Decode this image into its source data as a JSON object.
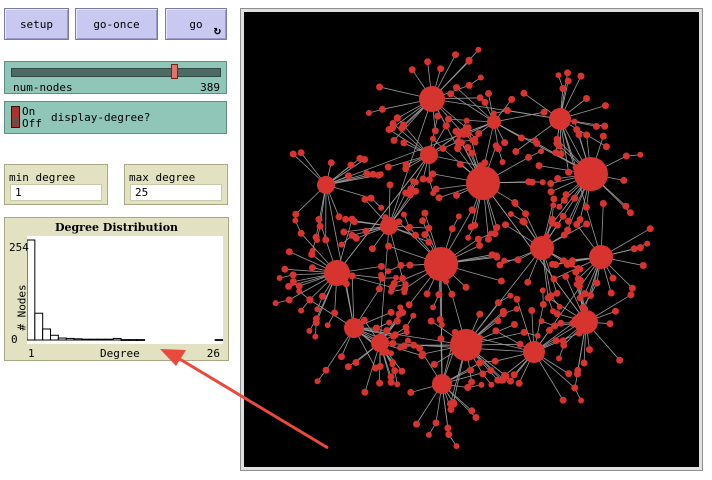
{
  "buttons": {
    "setup": "setup",
    "go_once": "go-once",
    "go": "go",
    "go_forever_icon": "forever-loop-icon"
  },
  "slider": {
    "name": "num-nodes",
    "value": "389",
    "fraction": 0.79
  },
  "switch": {
    "on_label": "On",
    "off_label": "Off",
    "name": "display-degree?",
    "state": "off"
  },
  "monitors": {
    "min_label": "min degree",
    "min_value": "1",
    "max_label": "max degree",
    "max_value": "25"
  },
  "plot": {
    "title": "Degree Distribution",
    "ylabel": "# Nodes",
    "xlabel": "Degree",
    "ymax_label": "254",
    "ymin_label": "0",
    "xmin_label": "1",
    "xmax_label": "26"
  },
  "chart_data": {
    "type": "bar",
    "title": "Degree Distribution",
    "xlabel": "Degree",
    "ylabel": "# Nodes",
    "x": [
      1,
      2,
      3,
      4,
      5,
      6,
      7,
      8,
      9,
      10,
      11,
      12,
      13,
      14,
      15,
      16,
      17,
      18,
      19,
      20,
      21,
      22,
      23,
      24,
      25
    ],
    "values": [
      254,
      68,
      28,
      12,
      5,
      4,
      3,
      2,
      2,
      2,
      2,
      4,
      1,
      1,
      1,
      0,
      0,
      0,
      0,
      0,
      0,
      0,
      0,
      0,
      1
    ],
    "xlim": [
      1,
      26
    ],
    "ylim": [
      0,
      254
    ]
  },
  "view": {
    "background_color": "#000000",
    "node_color": "#d7332f",
    "link_color": "#9a9a9a",
    "num_nodes": 389
  },
  "annotation": {
    "arrow_color": "#ea4a3c"
  }
}
